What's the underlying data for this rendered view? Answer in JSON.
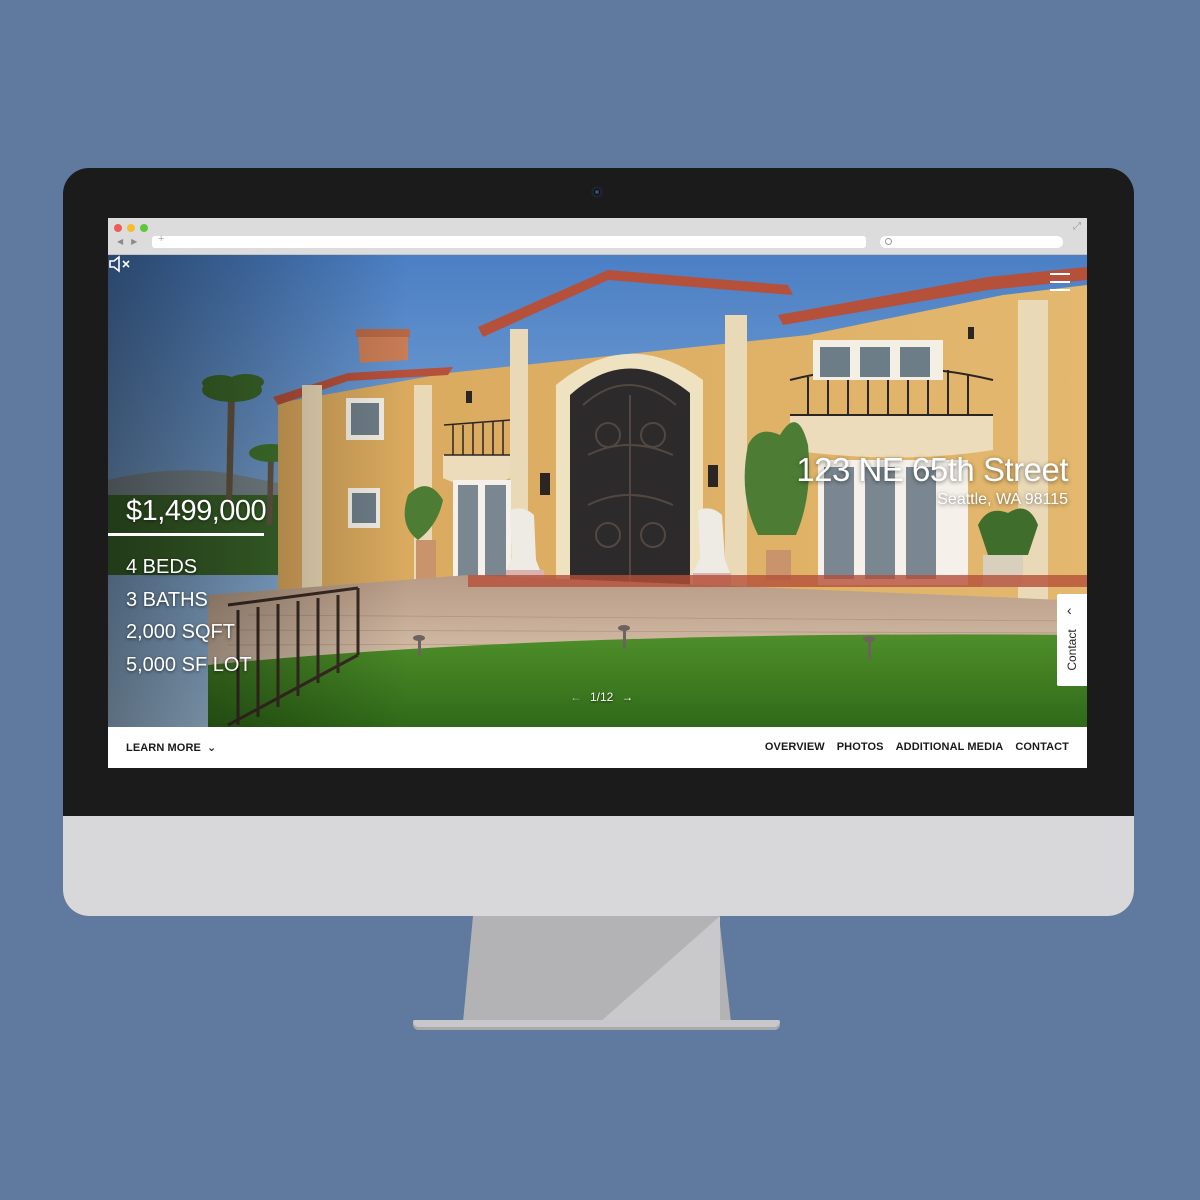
{
  "listing": {
    "price": "$1,499,000",
    "specs": [
      "4 BEDS",
      "3 BATHS",
      "2,000 SQFT",
      "5,000 SF LOT"
    ],
    "street": "123 NE 65th Street",
    "city": "Seattle, WA 98115"
  },
  "gallery": {
    "counter": "1/12"
  },
  "contact_tab": {
    "label": "Contact"
  },
  "nav": {
    "learn_more": "LEARN MORE",
    "links": [
      "OVERVIEW",
      "PHOTOS",
      "ADDITIONAL MEDIA",
      "CONTACT"
    ]
  },
  "icons": {
    "mute": "speaker-muted-icon",
    "menu": "hamburger-menu-icon",
    "prev": "arrow-left-icon",
    "next": "arrow-right-icon",
    "learn_more_chevron": "chevron-down-icon",
    "contact_chevron": "chevron-left-icon"
  },
  "colors": {
    "background": "#5f7a9e",
    "bezel": "#1b1b1c",
    "chin": "#d8d8da",
    "text_on_photo": "#ffffff",
    "nav_text": "#1a1a1a"
  }
}
